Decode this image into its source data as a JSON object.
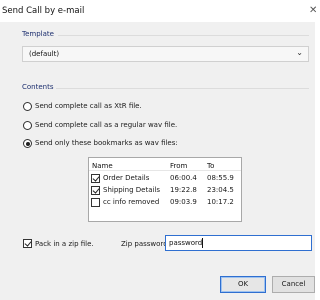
{
  "window": {
    "title": "Send Call by e-mail"
  },
  "template": {
    "label": "Template",
    "selected": "(default)"
  },
  "contents": {
    "label": "Contents",
    "options": [
      "Send complete call as XtR file.",
      "Send complete call as a regular wav file.",
      "Send only these bookmarks as wav files:"
    ],
    "selected_index": 2
  },
  "bookmarks": {
    "columns": [
      "Name",
      "From",
      "To"
    ],
    "rows": [
      {
        "name": "Order Details",
        "from": "06:00.4",
        "to": "08:55.9",
        "checked": true
      },
      {
        "name": "Shipping Details",
        "from": "19:22.8",
        "to": "23:04.5",
        "checked": true
      },
      {
        "name": "cc info removed",
        "from": "09:03.9",
        "to": "10:17.2",
        "checked": false
      }
    ]
  },
  "zip": {
    "pack_label": "Pack in a zip file.",
    "pack_checked": true,
    "password_label": "Zip password:",
    "password_value": "password"
  },
  "buttons": {
    "ok": "OK",
    "cancel": "Cancel"
  }
}
